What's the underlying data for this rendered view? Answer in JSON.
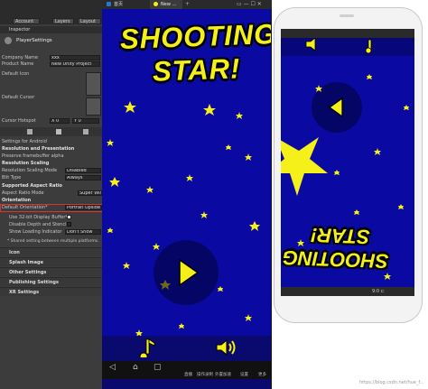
{
  "unity": {
    "tabs": {
      "account": "Account",
      "layers": "Layers",
      "layout": "Layout"
    },
    "inspector_tab": "Inspector",
    "player_settings": "PlayerSettings",
    "company_name_label": "Company Name",
    "company_name_value": "xxx",
    "product_name_label": "Product Name",
    "product_name_value": "New Unity Project",
    "default_icon_label": "Default Icon",
    "default_cursor_label": "Default Cursor",
    "cursor_hotspot_label": "Cursor Hotspot",
    "hotspot_x": "X  0",
    "hotspot_y": "Y  0",
    "settings_for": "Settings for Android",
    "resolution_presentation": "Resolution and Presentation",
    "preserve_framebuffer": "Preserve framebuffer alpha",
    "resolution_scaling": "Resolution Scaling",
    "resolution_scaling_mode_label": "Resolution Scaling Mode",
    "resolution_scaling_mode_value": "Disabled",
    "blit_type_label": "Blit Type",
    "blit_type_value": "Always",
    "supported_aspect_ratio": "Supported Aspect Ratio",
    "aspect_ratio_mode_label": "Aspect Ratio Mode",
    "aspect_ratio_mode_value": "Super Wide Screen",
    "orientation": "Orientation",
    "default_orientation_label": "Default Orientation*",
    "default_orientation_value": "Portrait Upside Down",
    "use_32bit_label": "Use 32-bit Display Buffer*",
    "disable_depth_label": "Disable Depth and Stencil*",
    "show_loading_label": "Show Loading Indicator",
    "show_loading_value": "Don't Show",
    "shared_note": "* Shared setting between multiple platforms.",
    "icon_section": "Icon",
    "splash_section": "Splash Image",
    "other_section": "Other Settings",
    "publishing_section": "Publishing Settings",
    "xr_section": "XR Settings"
  },
  "emulator": {
    "tab_home": "首页",
    "tab_game": "New ...",
    "game_title_line1": "SHOOTING",
    "game_title_line2": "STAR!",
    "nav_labels": [
      "直播",
      "操作录制",
      "外置加速",
      "设置",
      "更多"
    ]
  },
  "phone": {
    "flipped_title_line1": "SHOOTING",
    "flipped_title_line2": "STAR!",
    "status_text": "9:0 ⊏",
    "watermark": "https://blog.csdn.net/hue_f..."
  },
  "colors": {
    "game_blue": "#0a0aa2",
    "title_yellow": "#f5ef1a",
    "unity_panel": "#3c3c3c",
    "highlight_red": "#e03030"
  },
  "icons": [
    "play-icon",
    "music-note-icon",
    "speaker-icon",
    "star-icon",
    "back-arrow-icon",
    "home-icon",
    "recents-icon"
  ]
}
